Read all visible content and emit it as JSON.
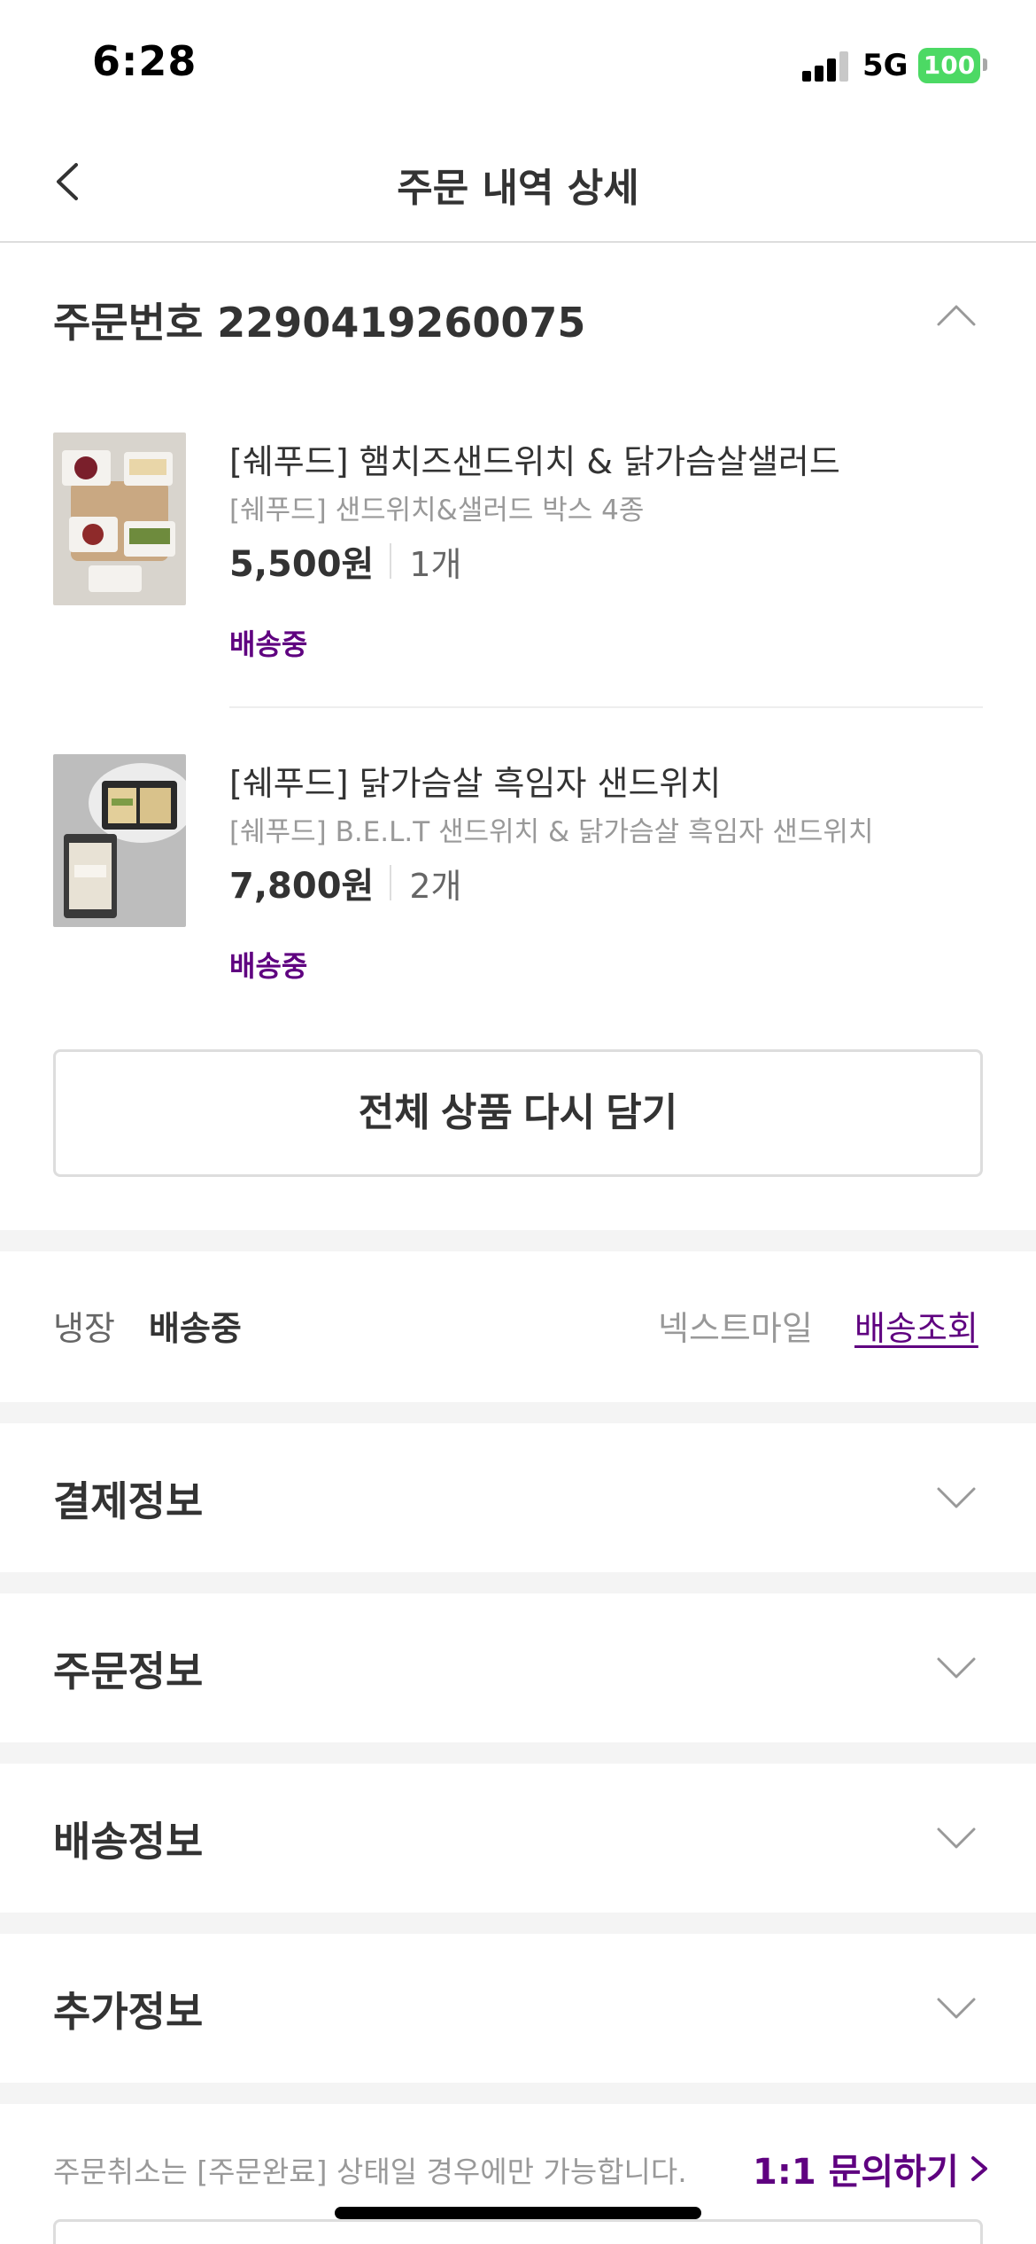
{
  "status_bar": {
    "time": "6:28",
    "network": "5G",
    "battery": "100",
    "battery_color": "#4cd964"
  },
  "header": {
    "title": "주문 내역 상세",
    "back_icon": "chevron-left-icon"
  },
  "order": {
    "number_label": "주문번호 2290419260075",
    "collapse_icon": "chevron-up-icon",
    "products": [
      {
        "name": "[쉐푸드] 햄치즈샌드위치 & 닭가슴살샐러드",
        "option": "[쉐푸드] 샌드위치&샐러드 박스 4종",
        "price": "5,500원",
        "quantity": "1개",
        "status": "배송중"
      },
      {
        "name": "[쉐푸드] 닭가슴살 흑임자 샌드위치",
        "option": "[쉐푸드] B.E.L.T 샌드위치 & 닭가슴살 흑임자 샌드위치",
        "price": "7,800원",
        "quantity": "2개",
        "status": "배송중"
      }
    ],
    "readd_button": "전체 상품 다시 담기"
  },
  "delivery": {
    "temperature": "냉장",
    "status": "배송중",
    "carrier": "넥스트마일",
    "track_link": "배송조회"
  },
  "sections": [
    {
      "title": "결제정보",
      "icon": "chevron-down-icon"
    },
    {
      "title": "주문정보",
      "icon": "chevron-down-icon"
    },
    {
      "title": "배송정보",
      "icon": "chevron-down-icon"
    },
    {
      "title": "추가정보",
      "icon": "chevron-down-icon"
    }
  ],
  "footer": {
    "note": "주문취소는 [주문완료] 상태일 경우에만 가능합니다.",
    "inquiry_link": "1:1 문의하기"
  },
  "colors": {
    "accent": "#5f0080",
    "text": "#333333",
    "muted": "#999999",
    "border": "#dddddd",
    "section_gap": "#f4f4f4"
  }
}
